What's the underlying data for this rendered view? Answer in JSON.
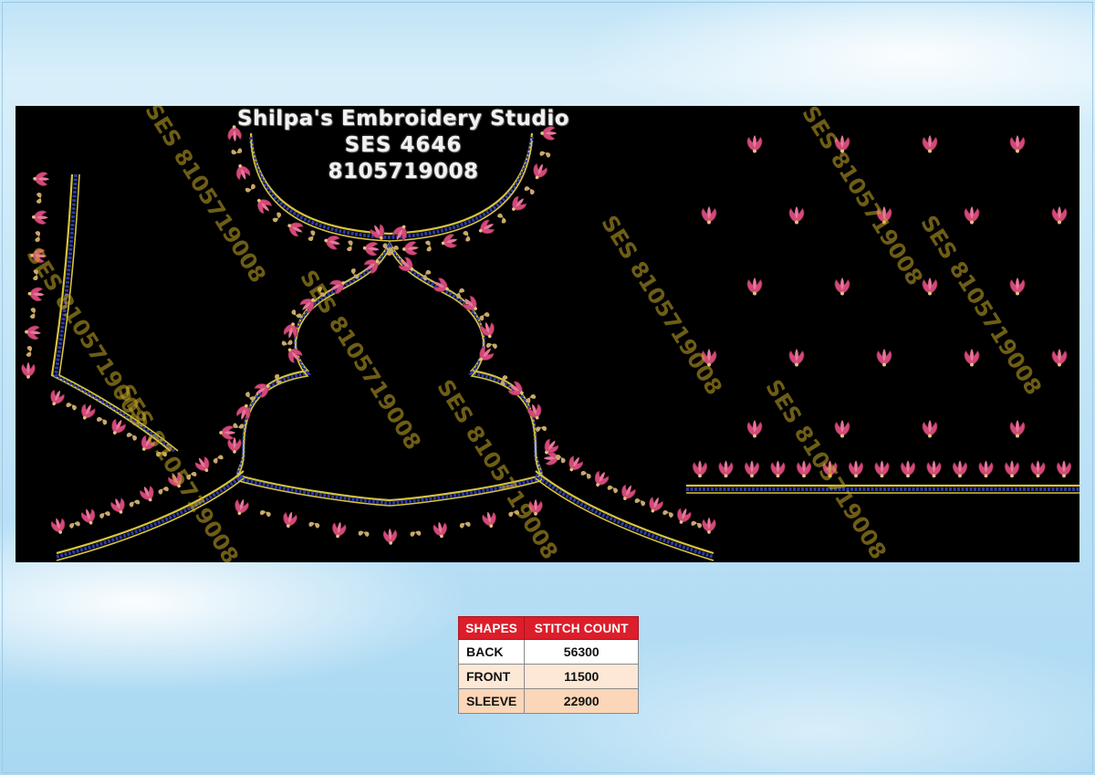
{
  "studio": {
    "name": "Shilpa's Embroidery Studio",
    "code": "SES  4646",
    "phone": "8105719008"
  },
  "watermarks": [
    "SES 8105719008",
    "SES 8105719008",
    "SES 8105719008",
    "SES 8105719008",
    "SES 8105719008",
    "SES 8105719008",
    "SES 8105719008",
    "SES 8105719008",
    "SES 8105719008"
  ],
  "colors": {
    "background": "#000000",
    "gold_line": "#d8c43a",
    "blue_line": "#2c3aa0",
    "flower_pink": "#d24a78",
    "leaf_gold": "#c9a96b",
    "table_header": "#dc1e2b"
  },
  "table": {
    "headers": [
      "SHAPES",
      "STITCH COUNT"
    ],
    "rows": [
      {
        "shape": "BACK",
        "count": "56300"
      },
      {
        "shape": "FRONT",
        "count": "11500"
      },
      {
        "shape": "SLEEVE",
        "count": "22900"
      }
    ]
  }
}
